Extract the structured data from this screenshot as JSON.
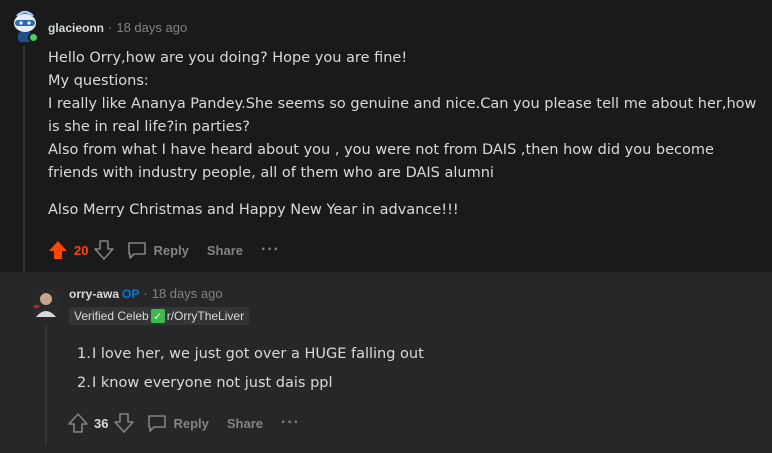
{
  "comment": {
    "username": "glacieonn",
    "separator": "·",
    "timestamp": "18 days ago",
    "paragraphs": [
      "Hello Orry,how are you doing? Hope you are fine!",
      "My questions:",
      "I really like Ananya Pandey.She seems so genuine and nice.Can you please tell me about her,how is she in real life?in parties?",
      "Also from what I have heard about you , you were not from DAIS ,then how did you become friends with industry people, all of them who are DAIS alumni",
      "Also Merry Christmas and Happy New Year in advance!!!"
    ],
    "votes": "20",
    "reply_label": "Reply",
    "share_label": "Share",
    "more_label": "···"
  },
  "reply": {
    "username": "orry-awa",
    "op_label": "OP",
    "separator": "·",
    "timestamp": "18 days ago",
    "flair_text": "Verified Celeb",
    "flair_sub": "r/OrryTheLiver",
    "items": [
      {
        "num": "1.",
        "text": "I love her, we just got over a HUGE falling out"
      },
      {
        "num": "2.",
        "text": "I know everyone not just dais ppl"
      }
    ],
    "votes": "36",
    "reply_label": "Reply",
    "share_label": "Share",
    "more_label": "···"
  },
  "colors": {
    "background": "#1a1a1b",
    "reply_background": "#272729",
    "upvote_active": "#ff4500",
    "op_blue": "#0079d3",
    "online_green": "#46d160"
  },
  "icons": {
    "upvote": "arrow-up-icon",
    "downvote": "arrow-down-icon",
    "reply": "chat-bubble-icon",
    "more": "ellipsis-icon",
    "check": "check-mark-icon"
  }
}
